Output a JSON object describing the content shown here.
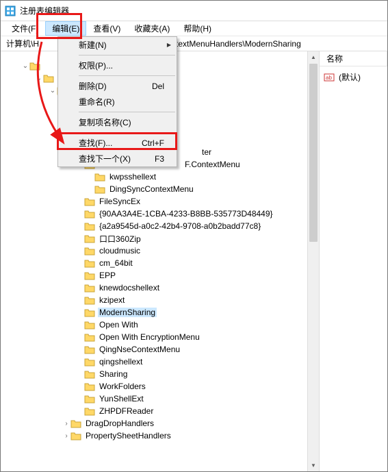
{
  "window": {
    "title": "注册表编辑器"
  },
  "menubar": {
    "file": "文件(F)",
    "edit": "编辑(E)",
    "view": "查看(V)",
    "favorites": "收藏夹(A)",
    "help": "帮助(H)"
  },
  "addressbar": {
    "label": "计算机\\H",
    "path_tail": "textMenuHandlers\\ModernSharing"
  },
  "edit_menu": {
    "new": "新建(N)",
    "permissions": "权限(P)...",
    "delete": "删除(D)",
    "delete_sc": "Del",
    "rename": "重命名(R)",
    "copy_key_name": "复制项名称(C)",
    "find": "查找(F)...",
    "find_sc": "Ctrl+F",
    "find_next": "查找下一个(X)",
    "find_next_sc": "F3"
  },
  "tree": {
    "items": [
      "ter",
      "F.ContextMenu",
      "kwpsshellext",
      "DingSyncContextMenu",
      "FileSyncEx",
      "{90AA3A4E-1CBA-4233-B8BB-535773D48449}",
      "{a2a9545d-a0c2-42b4-9708-a0b2badd77c8}",
      "口口360Zip",
      "cloudmusic",
      "cm_64bit",
      "EPP",
      "knewdocshellext",
      "kzipext",
      "ModernSharing",
      "Open With",
      "Open With EncryptionMenu",
      "QingNseContextMenu",
      "qingshellext",
      "Sharing",
      "WorkFolders",
      "YunShellExt",
      "ZHPDFReader"
    ],
    "drag_drop": "DragDropHandlers",
    "prop_sheet": "PropertySheetHandlers"
  },
  "right": {
    "col_name": "名称",
    "default_value": "(默认)"
  }
}
